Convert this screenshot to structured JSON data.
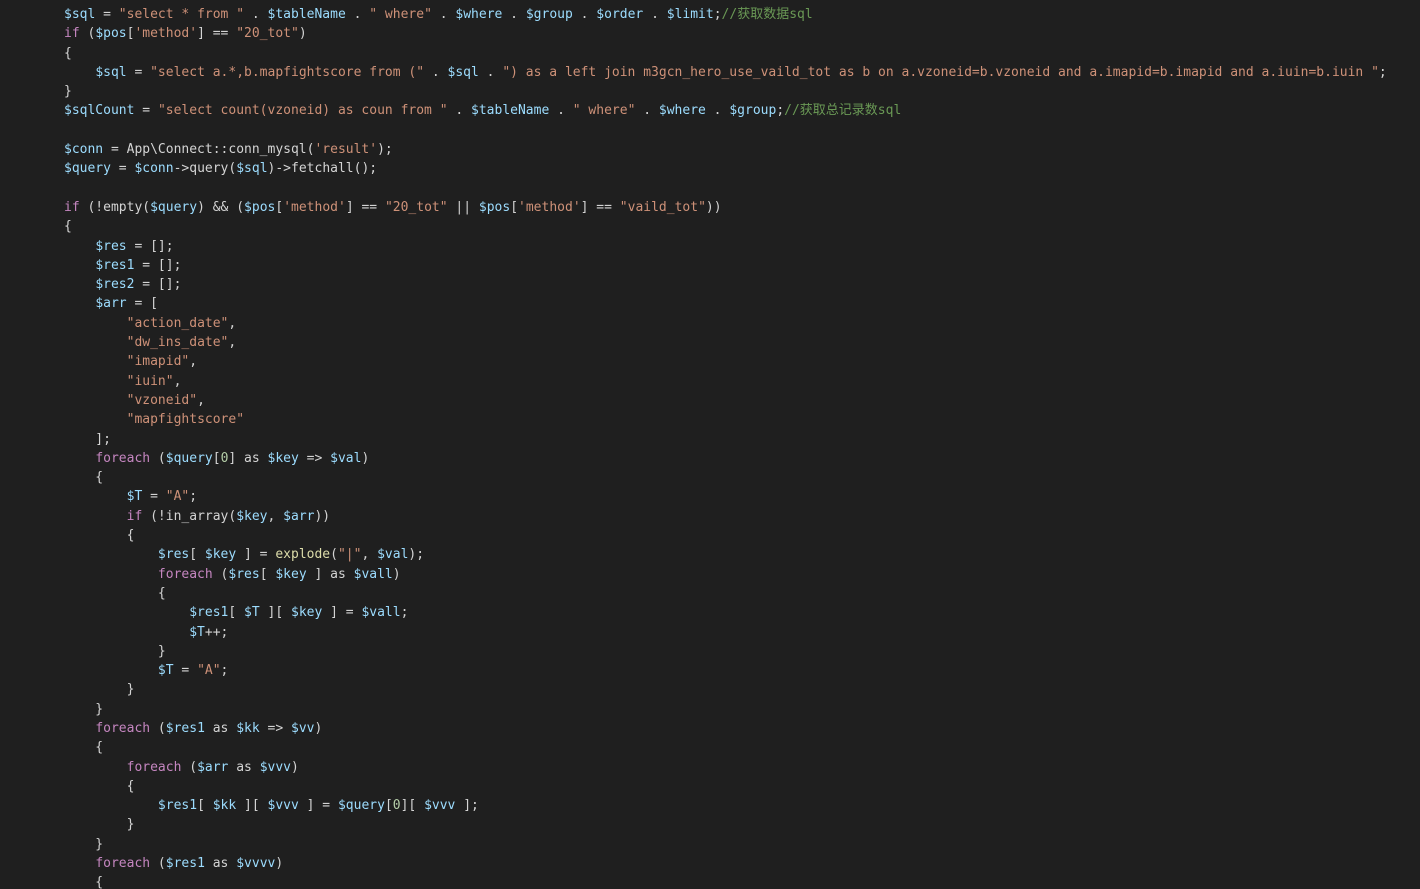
{
  "editor": {
    "language": "PHP",
    "theme": "Dark+ (dark charcoal)",
    "background_color": "#1f1f1f",
    "default_text_color": "#d4d4d4",
    "colors": {
      "variable": "#9cdcfe",
      "string": "#ce9178",
      "keyword": "#c586c0",
      "comment": "#6a9955",
      "function": "#dcdcaa",
      "number": "#b5cea8",
      "plain": "#d4d4d4"
    }
  },
  "code": {
    "lines": [
      {
        "n": 1,
        "tokens": [
          {
            "t": "$sql",
            "c": "var"
          },
          {
            "t": " = ",
            "c": "plain"
          },
          {
            "t": "\"select * from \"",
            "c": "str"
          },
          {
            "t": " . ",
            "c": "plain"
          },
          {
            "t": "$tableName",
            "c": "var"
          },
          {
            "t": " . ",
            "c": "plain"
          },
          {
            "t": "\" where\"",
            "c": "str"
          },
          {
            "t": " . ",
            "c": "plain"
          },
          {
            "t": "$where",
            "c": "var"
          },
          {
            "t": " . ",
            "c": "plain"
          },
          {
            "t": "$group",
            "c": "var"
          },
          {
            "t": " . ",
            "c": "plain"
          },
          {
            "t": "$order",
            "c": "var"
          },
          {
            "t": " . ",
            "c": "plain"
          },
          {
            "t": "$limit",
            "c": "var"
          },
          {
            "t": ";",
            "c": "plain"
          },
          {
            "t": "//获取数据sql",
            "c": "cmt"
          }
        ]
      },
      {
        "n": 2,
        "tokens": [
          {
            "t": "if",
            "c": "kw"
          },
          {
            "t": " (",
            "c": "plain"
          },
          {
            "t": "$pos",
            "c": "var"
          },
          {
            "t": "[",
            "c": "plain"
          },
          {
            "t": "'method'",
            "c": "str"
          },
          {
            "t": "] == ",
            "c": "plain"
          },
          {
            "t": "\"20_tot\"",
            "c": "str"
          },
          {
            "t": ")",
            "c": "plain"
          }
        ]
      },
      {
        "n": 3,
        "tokens": [
          {
            "t": "{",
            "c": "plain"
          }
        ]
      },
      {
        "n": 4,
        "tokens": [
          {
            "t": "    ",
            "c": "plain"
          },
          {
            "t": "$sql",
            "c": "var"
          },
          {
            "t": " = ",
            "c": "plain"
          },
          {
            "t": "\"select a.*,b.mapfightscore from (\"",
            "c": "str"
          },
          {
            "t": " . ",
            "c": "plain"
          },
          {
            "t": "$sql",
            "c": "var"
          },
          {
            "t": " . ",
            "c": "plain"
          },
          {
            "t": "\") as a left join m3gcn_hero_use_vaild_tot as b on a.vzoneid=b.vzoneid and a.imapid=b.imapid and a.iuin=b.iuin \"",
            "c": "str"
          },
          {
            "t": ";",
            "c": "plain"
          }
        ]
      },
      {
        "n": 5,
        "tokens": [
          {
            "t": "}",
            "c": "plain"
          }
        ]
      },
      {
        "n": 6,
        "tokens": [
          {
            "t": "$sqlCount",
            "c": "var"
          },
          {
            "t": " = ",
            "c": "plain"
          },
          {
            "t": "\"select count(vzoneid) as coun from \"",
            "c": "str"
          },
          {
            "t": " . ",
            "c": "plain"
          },
          {
            "t": "$tableName",
            "c": "var"
          },
          {
            "t": " . ",
            "c": "plain"
          },
          {
            "t": "\" where\"",
            "c": "str"
          },
          {
            "t": " . ",
            "c": "plain"
          },
          {
            "t": "$where",
            "c": "var"
          },
          {
            "t": " . ",
            "c": "plain"
          },
          {
            "t": "$group",
            "c": "var"
          },
          {
            "t": ";",
            "c": "plain"
          },
          {
            "t": "//获取总记录数sql",
            "c": "cmt"
          }
        ]
      },
      {
        "n": 7,
        "tokens": []
      },
      {
        "n": 8,
        "tokens": [
          {
            "t": "$conn",
            "c": "var"
          },
          {
            "t": " = App\\Connect::conn_mysql(",
            "c": "plain"
          },
          {
            "t": "'result'",
            "c": "str"
          },
          {
            "t": ");",
            "c": "plain"
          }
        ]
      },
      {
        "n": 9,
        "tokens": [
          {
            "t": "$query",
            "c": "var"
          },
          {
            "t": " = ",
            "c": "plain"
          },
          {
            "t": "$conn",
            "c": "var"
          },
          {
            "t": "->query(",
            "c": "plain"
          },
          {
            "t": "$sql",
            "c": "var"
          },
          {
            "t": ")->fetchall();",
            "c": "plain"
          }
        ]
      },
      {
        "n": 10,
        "tokens": []
      },
      {
        "n": 11,
        "tokens": [
          {
            "t": "if",
            "c": "kw"
          },
          {
            "t": " (!empty(",
            "c": "plain"
          },
          {
            "t": "$query",
            "c": "var"
          },
          {
            "t": ") && (",
            "c": "plain"
          },
          {
            "t": "$pos",
            "c": "var"
          },
          {
            "t": "[",
            "c": "plain"
          },
          {
            "t": "'method'",
            "c": "str"
          },
          {
            "t": "] == ",
            "c": "plain"
          },
          {
            "t": "\"20_tot\"",
            "c": "str"
          },
          {
            "t": " || ",
            "c": "plain"
          },
          {
            "t": "$pos",
            "c": "var"
          },
          {
            "t": "[",
            "c": "plain"
          },
          {
            "t": "'method'",
            "c": "str"
          },
          {
            "t": "] == ",
            "c": "plain"
          },
          {
            "t": "\"vaild_tot\"",
            "c": "str"
          },
          {
            "t": "))",
            "c": "plain"
          }
        ]
      },
      {
        "n": 12,
        "tokens": [
          {
            "t": "{",
            "c": "plain"
          }
        ]
      },
      {
        "n": 13,
        "tokens": [
          {
            "t": "    ",
            "c": "plain"
          },
          {
            "t": "$res",
            "c": "var"
          },
          {
            "t": " = [];",
            "c": "plain"
          }
        ]
      },
      {
        "n": 14,
        "tokens": [
          {
            "t": "    ",
            "c": "plain"
          },
          {
            "t": "$res1",
            "c": "var"
          },
          {
            "t": " = [];",
            "c": "plain"
          }
        ]
      },
      {
        "n": 15,
        "tokens": [
          {
            "t": "    ",
            "c": "plain"
          },
          {
            "t": "$res2",
            "c": "var"
          },
          {
            "t": " = [];",
            "c": "plain"
          }
        ]
      },
      {
        "n": 16,
        "tokens": [
          {
            "t": "    ",
            "c": "plain"
          },
          {
            "t": "$arr",
            "c": "var"
          },
          {
            "t": " = [",
            "c": "plain"
          }
        ]
      },
      {
        "n": 17,
        "tokens": [
          {
            "t": "        ",
            "c": "plain"
          },
          {
            "t": "\"action_date\"",
            "c": "str"
          },
          {
            "t": ",",
            "c": "plain"
          }
        ]
      },
      {
        "n": 18,
        "tokens": [
          {
            "t": "        ",
            "c": "plain"
          },
          {
            "t": "\"dw_ins_date\"",
            "c": "str"
          },
          {
            "t": ",",
            "c": "plain"
          }
        ]
      },
      {
        "n": 19,
        "tokens": [
          {
            "t": "        ",
            "c": "plain"
          },
          {
            "t": "\"imapid\"",
            "c": "str"
          },
          {
            "t": ",",
            "c": "plain"
          }
        ]
      },
      {
        "n": 20,
        "tokens": [
          {
            "t": "        ",
            "c": "plain"
          },
          {
            "t": "\"iuin\"",
            "c": "str"
          },
          {
            "t": ",",
            "c": "plain"
          }
        ]
      },
      {
        "n": 21,
        "tokens": [
          {
            "t": "        ",
            "c": "plain"
          },
          {
            "t": "\"vzoneid\"",
            "c": "str"
          },
          {
            "t": ",",
            "c": "plain"
          }
        ]
      },
      {
        "n": 22,
        "tokens": [
          {
            "t": "        ",
            "c": "plain"
          },
          {
            "t": "\"mapfightscore\"",
            "c": "str"
          }
        ]
      },
      {
        "n": 23,
        "tokens": [
          {
            "t": "    ];",
            "c": "plain"
          }
        ]
      },
      {
        "n": 24,
        "tokens": [
          {
            "t": "    ",
            "c": "plain"
          },
          {
            "t": "foreach",
            "c": "kw"
          },
          {
            "t": " (",
            "c": "plain"
          },
          {
            "t": "$query",
            "c": "var"
          },
          {
            "t": "[",
            "c": "plain"
          },
          {
            "t": "0",
            "c": "num"
          },
          {
            "t": "] as ",
            "c": "plain"
          },
          {
            "t": "$key",
            "c": "var"
          },
          {
            "t": " => ",
            "c": "plain"
          },
          {
            "t": "$val",
            "c": "var"
          },
          {
            "t": ")",
            "c": "plain"
          }
        ]
      },
      {
        "n": 25,
        "tokens": [
          {
            "t": "    {",
            "c": "plain"
          }
        ]
      },
      {
        "n": 26,
        "tokens": [
          {
            "t": "        ",
            "c": "plain"
          },
          {
            "t": "$T",
            "c": "var"
          },
          {
            "t": " = ",
            "c": "plain"
          },
          {
            "t": "\"A\"",
            "c": "str"
          },
          {
            "t": ";",
            "c": "plain"
          }
        ]
      },
      {
        "n": 27,
        "tokens": [
          {
            "t": "        ",
            "c": "plain"
          },
          {
            "t": "if",
            "c": "kw"
          },
          {
            "t": " (!in_array(",
            "c": "plain"
          },
          {
            "t": "$key",
            "c": "var"
          },
          {
            "t": ", ",
            "c": "plain"
          },
          {
            "t": "$arr",
            "c": "var"
          },
          {
            "t": "))",
            "c": "plain"
          }
        ]
      },
      {
        "n": 28,
        "tokens": [
          {
            "t": "        {",
            "c": "plain"
          }
        ]
      },
      {
        "n": 29,
        "tokens": [
          {
            "t": "            ",
            "c": "plain"
          },
          {
            "t": "$res",
            "c": "var"
          },
          {
            "t": "[ ",
            "c": "plain"
          },
          {
            "t": "$key",
            "c": "var"
          },
          {
            "t": " ] = ",
            "c": "plain"
          },
          {
            "t": "explode",
            "c": "fn"
          },
          {
            "t": "(",
            "c": "plain"
          },
          {
            "t": "\"|\"",
            "c": "str"
          },
          {
            "t": ", ",
            "c": "plain"
          },
          {
            "t": "$val",
            "c": "var"
          },
          {
            "t": ");",
            "c": "plain"
          }
        ]
      },
      {
        "n": 30,
        "tokens": [
          {
            "t": "            ",
            "c": "plain"
          },
          {
            "t": "foreach",
            "c": "kw"
          },
          {
            "t": " (",
            "c": "plain"
          },
          {
            "t": "$res",
            "c": "var"
          },
          {
            "t": "[ ",
            "c": "plain"
          },
          {
            "t": "$key",
            "c": "var"
          },
          {
            "t": " ] as ",
            "c": "plain"
          },
          {
            "t": "$vall",
            "c": "var"
          },
          {
            "t": ")",
            "c": "plain"
          }
        ]
      },
      {
        "n": 31,
        "tokens": [
          {
            "t": "            {",
            "c": "plain"
          }
        ]
      },
      {
        "n": 32,
        "tokens": [
          {
            "t": "                ",
            "c": "plain"
          },
          {
            "t": "$res1",
            "c": "var"
          },
          {
            "t": "[ ",
            "c": "plain"
          },
          {
            "t": "$T",
            "c": "var"
          },
          {
            "t": " ][ ",
            "c": "plain"
          },
          {
            "t": "$key",
            "c": "var"
          },
          {
            "t": " ] = ",
            "c": "plain"
          },
          {
            "t": "$vall",
            "c": "var"
          },
          {
            "t": ";",
            "c": "plain"
          }
        ]
      },
      {
        "n": 33,
        "tokens": [
          {
            "t": "                ",
            "c": "plain"
          },
          {
            "t": "$T",
            "c": "var"
          },
          {
            "t": "++;",
            "c": "plain"
          }
        ]
      },
      {
        "n": 34,
        "tokens": [
          {
            "t": "            }",
            "c": "plain"
          }
        ]
      },
      {
        "n": 35,
        "tokens": [
          {
            "t": "            ",
            "c": "plain"
          },
          {
            "t": "$T",
            "c": "var"
          },
          {
            "t": " = ",
            "c": "plain"
          },
          {
            "t": "\"A\"",
            "c": "str"
          },
          {
            "t": ";",
            "c": "plain"
          }
        ]
      },
      {
        "n": 36,
        "tokens": [
          {
            "t": "        }",
            "c": "plain"
          }
        ]
      },
      {
        "n": 37,
        "tokens": [
          {
            "t": "    }",
            "c": "plain"
          }
        ]
      },
      {
        "n": 38,
        "tokens": [
          {
            "t": "    ",
            "c": "plain"
          },
          {
            "t": "foreach",
            "c": "kw"
          },
          {
            "t": " (",
            "c": "plain"
          },
          {
            "t": "$res1",
            "c": "var"
          },
          {
            "t": " as ",
            "c": "plain"
          },
          {
            "t": "$kk",
            "c": "var"
          },
          {
            "t": " => ",
            "c": "plain"
          },
          {
            "t": "$vv",
            "c": "var"
          },
          {
            "t": ")",
            "c": "plain"
          }
        ]
      },
      {
        "n": 39,
        "tokens": [
          {
            "t": "    {",
            "c": "plain"
          }
        ]
      },
      {
        "n": 40,
        "tokens": [
          {
            "t": "        ",
            "c": "plain"
          },
          {
            "t": "foreach",
            "c": "kw"
          },
          {
            "t": " (",
            "c": "plain"
          },
          {
            "t": "$arr",
            "c": "var"
          },
          {
            "t": " as ",
            "c": "plain"
          },
          {
            "t": "$vvv",
            "c": "var"
          },
          {
            "t": ")",
            "c": "plain"
          }
        ]
      },
      {
        "n": 41,
        "tokens": [
          {
            "t": "        {",
            "c": "plain"
          }
        ]
      },
      {
        "n": 42,
        "tokens": [
          {
            "t": "            ",
            "c": "plain"
          },
          {
            "t": "$res1",
            "c": "var"
          },
          {
            "t": "[ ",
            "c": "plain"
          },
          {
            "t": "$kk",
            "c": "var"
          },
          {
            "t": " ][ ",
            "c": "plain"
          },
          {
            "t": "$vvv",
            "c": "var"
          },
          {
            "t": " ] = ",
            "c": "plain"
          },
          {
            "t": "$query",
            "c": "var"
          },
          {
            "t": "[",
            "c": "plain"
          },
          {
            "t": "0",
            "c": "num"
          },
          {
            "t": "][ ",
            "c": "plain"
          },
          {
            "t": "$vvv",
            "c": "var"
          },
          {
            "t": " ];",
            "c": "plain"
          }
        ]
      },
      {
        "n": 43,
        "tokens": [
          {
            "t": "        }",
            "c": "plain"
          }
        ]
      },
      {
        "n": 44,
        "tokens": [
          {
            "t": "    }",
            "c": "plain"
          }
        ]
      },
      {
        "n": 45,
        "tokens": [
          {
            "t": "    ",
            "c": "plain"
          },
          {
            "t": "foreach",
            "c": "kw"
          },
          {
            "t": " (",
            "c": "plain"
          },
          {
            "t": "$res1",
            "c": "var"
          },
          {
            "t": " as ",
            "c": "plain"
          },
          {
            "t": "$vvvv",
            "c": "var"
          },
          {
            "t": ")",
            "c": "plain"
          }
        ]
      },
      {
        "n": 46,
        "tokens": [
          {
            "t": "    {",
            "c": "plain"
          }
        ]
      }
    ]
  }
}
